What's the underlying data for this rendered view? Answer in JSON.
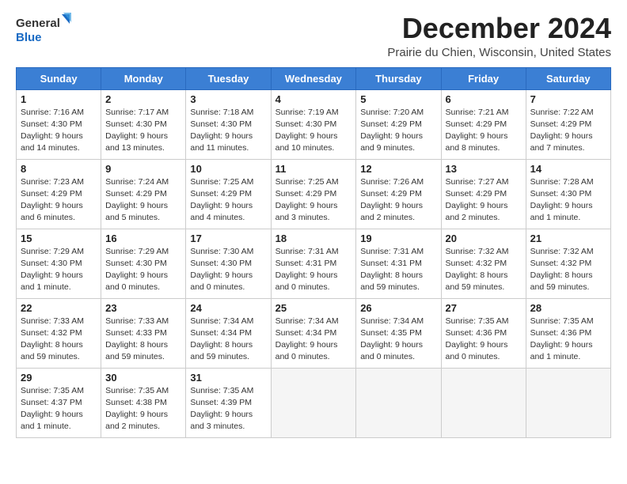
{
  "header": {
    "logo_general": "General",
    "logo_blue": "Blue",
    "month_title": "December 2024",
    "location": "Prairie du Chien, Wisconsin, United States"
  },
  "days_of_week": [
    "Sunday",
    "Monday",
    "Tuesday",
    "Wednesday",
    "Thursday",
    "Friday",
    "Saturday"
  ],
  "weeks": [
    [
      {
        "day": "1",
        "info": "Sunrise: 7:16 AM\nSunset: 4:30 PM\nDaylight: 9 hours\nand 14 minutes."
      },
      {
        "day": "2",
        "info": "Sunrise: 7:17 AM\nSunset: 4:30 PM\nDaylight: 9 hours\nand 13 minutes."
      },
      {
        "day": "3",
        "info": "Sunrise: 7:18 AM\nSunset: 4:30 PM\nDaylight: 9 hours\nand 11 minutes."
      },
      {
        "day": "4",
        "info": "Sunrise: 7:19 AM\nSunset: 4:30 PM\nDaylight: 9 hours\nand 10 minutes."
      },
      {
        "day": "5",
        "info": "Sunrise: 7:20 AM\nSunset: 4:29 PM\nDaylight: 9 hours\nand 9 minutes."
      },
      {
        "day": "6",
        "info": "Sunrise: 7:21 AM\nSunset: 4:29 PM\nDaylight: 9 hours\nand 8 minutes."
      },
      {
        "day": "7",
        "info": "Sunrise: 7:22 AM\nSunset: 4:29 PM\nDaylight: 9 hours\nand 7 minutes."
      }
    ],
    [
      {
        "day": "8",
        "info": "Sunrise: 7:23 AM\nSunset: 4:29 PM\nDaylight: 9 hours\nand 6 minutes."
      },
      {
        "day": "9",
        "info": "Sunrise: 7:24 AM\nSunset: 4:29 PM\nDaylight: 9 hours\nand 5 minutes."
      },
      {
        "day": "10",
        "info": "Sunrise: 7:25 AM\nSunset: 4:29 PM\nDaylight: 9 hours\nand 4 minutes."
      },
      {
        "day": "11",
        "info": "Sunrise: 7:25 AM\nSunset: 4:29 PM\nDaylight: 9 hours\nand 3 minutes."
      },
      {
        "day": "12",
        "info": "Sunrise: 7:26 AM\nSunset: 4:29 PM\nDaylight: 9 hours\nand 2 minutes."
      },
      {
        "day": "13",
        "info": "Sunrise: 7:27 AM\nSunset: 4:29 PM\nDaylight: 9 hours\nand 2 minutes."
      },
      {
        "day": "14",
        "info": "Sunrise: 7:28 AM\nSunset: 4:30 PM\nDaylight: 9 hours\nand 1 minute."
      }
    ],
    [
      {
        "day": "15",
        "info": "Sunrise: 7:29 AM\nSunset: 4:30 PM\nDaylight: 9 hours\nand 1 minute."
      },
      {
        "day": "16",
        "info": "Sunrise: 7:29 AM\nSunset: 4:30 PM\nDaylight: 9 hours\nand 0 minutes."
      },
      {
        "day": "17",
        "info": "Sunrise: 7:30 AM\nSunset: 4:30 PM\nDaylight: 9 hours\nand 0 minutes."
      },
      {
        "day": "18",
        "info": "Sunrise: 7:31 AM\nSunset: 4:31 PM\nDaylight: 9 hours\nand 0 minutes."
      },
      {
        "day": "19",
        "info": "Sunrise: 7:31 AM\nSunset: 4:31 PM\nDaylight: 8 hours\nand 59 minutes."
      },
      {
        "day": "20",
        "info": "Sunrise: 7:32 AM\nSunset: 4:32 PM\nDaylight: 8 hours\nand 59 minutes."
      },
      {
        "day": "21",
        "info": "Sunrise: 7:32 AM\nSunset: 4:32 PM\nDaylight: 8 hours\nand 59 minutes."
      }
    ],
    [
      {
        "day": "22",
        "info": "Sunrise: 7:33 AM\nSunset: 4:32 PM\nDaylight: 8 hours\nand 59 minutes."
      },
      {
        "day": "23",
        "info": "Sunrise: 7:33 AM\nSunset: 4:33 PM\nDaylight: 8 hours\nand 59 minutes."
      },
      {
        "day": "24",
        "info": "Sunrise: 7:34 AM\nSunset: 4:34 PM\nDaylight: 8 hours\nand 59 minutes."
      },
      {
        "day": "25",
        "info": "Sunrise: 7:34 AM\nSunset: 4:34 PM\nDaylight: 9 hours\nand 0 minutes."
      },
      {
        "day": "26",
        "info": "Sunrise: 7:34 AM\nSunset: 4:35 PM\nDaylight: 9 hours\nand 0 minutes."
      },
      {
        "day": "27",
        "info": "Sunrise: 7:35 AM\nSunset: 4:36 PM\nDaylight: 9 hours\nand 0 minutes."
      },
      {
        "day": "28",
        "info": "Sunrise: 7:35 AM\nSunset: 4:36 PM\nDaylight: 9 hours\nand 1 minute."
      }
    ],
    [
      {
        "day": "29",
        "info": "Sunrise: 7:35 AM\nSunset: 4:37 PM\nDaylight: 9 hours\nand 1 minute."
      },
      {
        "day": "30",
        "info": "Sunrise: 7:35 AM\nSunset: 4:38 PM\nDaylight: 9 hours\nand 2 minutes."
      },
      {
        "day": "31",
        "info": "Sunrise: 7:35 AM\nSunset: 4:39 PM\nDaylight: 9 hours\nand 3 minutes."
      },
      {
        "day": "",
        "info": ""
      },
      {
        "day": "",
        "info": ""
      },
      {
        "day": "",
        "info": ""
      },
      {
        "day": "",
        "info": ""
      }
    ]
  ]
}
